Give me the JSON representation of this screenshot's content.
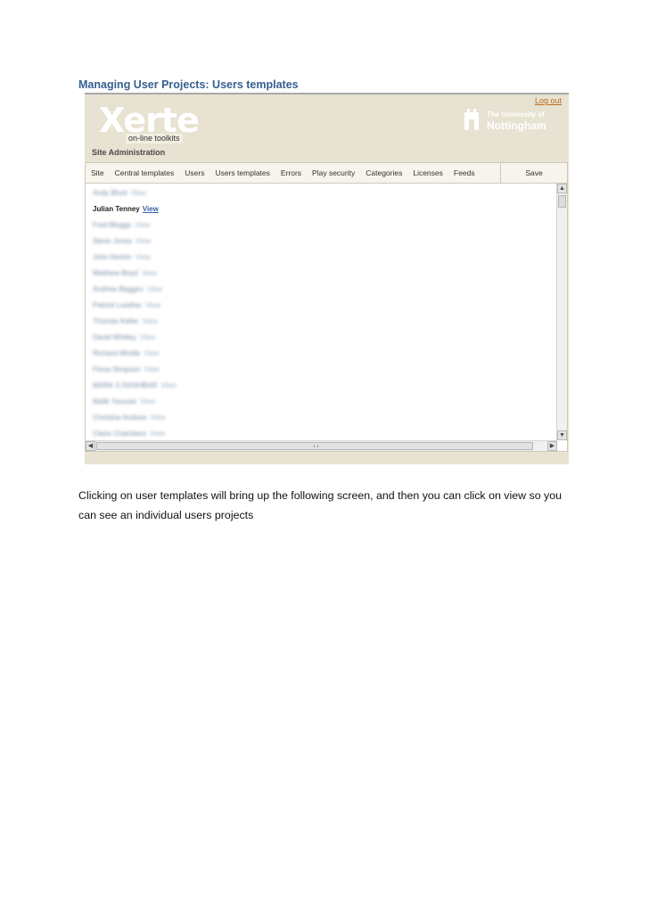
{
  "heading": "Managing User Projects: Users templates",
  "app": {
    "logout_label": "Log out",
    "logo_name": "Xerte",
    "logo_subtitle": "on-line toolkits",
    "university_line1": "The University of",
    "university_line2": "Nottingham",
    "admin_title": "Site Administration"
  },
  "tabs": [
    {
      "label": "Site"
    },
    {
      "label": "Central templates"
    },
    {
      "label": "Users"
    },
    {
      "label": "Users templates"
    },
    {
      "label": "Errors"
    },
    {
      "label": "Play security"
    },
    {
      "label": "Categories"
    },
    {
      "label": "Licenses"
    },
    {
      "label": "Feeds"
    }
  ],
  "save_label": "Save",
  "users": [
    {
      "name": "Andy Blunt",
      "view": "View",
      "blurred": true
    },
    {
      "name": "Julian Tenney",
      "view": "View",
      "blurred": false
    },
    {
      "name": "Fred Bloggs",
      "view": "View",
      "blurred": true
    },
    {
      "name": "Steve Jones",
      "view": "View",
      "blurred": true
    },
    {
      "name": "John Norton",
      "view": "View",
      "blurred": true
    },
    {
      "name": "Matthew Boyd",
      "view": "View",
      "blurred": true
    },
    {
      "name": "Andrew Baggen",
      "view": "View",
      "blurred": true
    },
    {
      "name": "Patrick Lowther",
      "view": "View",
      "blurred": true
    },
    {
      "name": "Thomas Keller",
      "view": "View",
      "blurred": true
    },
    {
      "name": "David Whitley",
      "view": "View",
      "blurred": true
    },
    {
      "name": "Richard Mindle",
      "view": "View",
      "blurred": true
    },
    {
      "name": "Fiona Simpson",
      "view": "View",
      "blurred": true
    },
    {
      "name": "MARK G RASHBAR",
      "view": "View",
      "blurred": true
    },
    {
      "name": "Malik Yousset",
      "view": "View",
      "blurred": true
    },
    {
      "name": "Christine Andrew",
      "view": "View",
      "blurred": true
    },
    {
      "name": "Claire Chambers",
      "view": "View",
      "blurred": true
    }
  ],
  "body_text": "Clicking on user templates will bring up the following screen, and then you can click on view so you can see an individual users projects"
}
